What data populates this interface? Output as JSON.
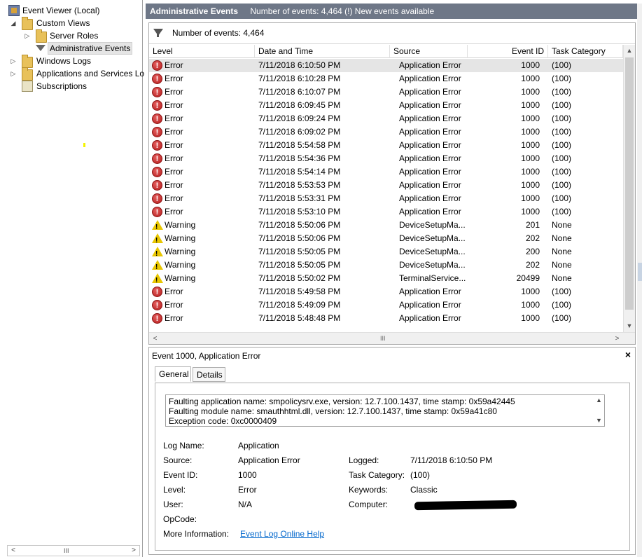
{
  "tree": {
    "items": [
      {
        "label": "Event Viewer (Local)",
        "icon": "event-viewer-icon"
      },
      {
        "label": "Custom Views",
        "icon": "folder-icon",
        "twisty": "◢"
      },
      {
        "label": "Server Roles",
        "icon": "folder-icon",
        "twisty": "▷"
      },
      {
        "label": "Administrative Events",
        "icon": "filter-icon",
        "selected": true
      },
      {
        "label": "Windows Logs",
        "icon": "folder-icon",
        "twisty": "▷"
      },
      {
        "label": "Applications and Services Lo",
        "icon": "folder-icon",
        "twisty": "▷"
      },
      {
        "label": "Subscriptions",
        "icon": "subscriptions-icon"
      }
    ],
    "scroll_left": "<",
    "scroll_right": ">",
    "scroll_grip": "III"
  },
  "header": {
    "title": "Administrative Events",
    "status": "Number of events: 4,464 (!) New events available"
  },
  "filterbar": {
    "text": "Number of events: 4,464"
  },
  "table": {
    "columns": [
      "Level",
      "Date and Time",
      "Source",
      "Event ID",
      "Task Category"
    ],
    "rows": [
      {
        "level": "Error",
        "date": "7/11/2018 6:10:50 PM",
        "source": "Application Error",
        "id": "1000",
        "cat": "(100)"
      },
      {
        "level": "Error",
        "date": "7/11/2018 6:10:28 PM",
        "source": "Application Error",
        "id": "1000",
        "cat": "(100)"
      },
      {
        "level": "Error",
        "date": "7/11/2018 6:10:07 PM",
        "source": "Application Error",
        "id": "1000",
        "cat": "(100)"
      },
      {
        "level": "Error",
        "date": "7/11/2018 6:09:45 PM",
        "source": "Application Error",
        "id": "1000",
        "cat": "(100)"
      },
      {
        "level": "Error",
        "date": "7/11/2018 6:09:24 PM",
        "source": "Application Error",
        "id": "1000",
        "cat": "(100)"
      },
      {
        "level": "Error",
        "date": "7/11/2018 6:09:02 PM",
        "source": "Application Error",
        "id": "1000",
        "cat": "(100)"
      },
      {
        "level": "Error",
        "date": "7/11/2018 5:54:58 PM",
        "source": "Application Error",
        "id": "1000",
        "cat": "(100)"
      },
      {
        "level": "Error",
        "date": "7/11/2018 5:54:36 PM",
        "source": "Application Error",
        "id": "1000",
        "cat": "(100)"
      },
      {
        "level": "Error",
        "date": "7/11/2018 5:54:14 PM",
        "source": "Application Error",
        "id": "1000",
        "cat": "(100)"
      },
      {
        "level": "Error",
        "date": "7/11/2018 5:53:53 PM",
        "source": "Application Error",
        "id": "1000",
        "cat": "(100)"
      },
      {
        "level": "Error",
        "date": "7/11/2018 5:53:31 PM",
        "source": "Application Error",
        "id": "1000",
        "cat": "(100)"
      },
      {
        "level": "Error",
        "date": "7/11/2018 5:53:10 PM",
        "source": "Application Error",
        "id": "1000",
        "cat": "(100)"
      },
      {
        "level": "Warning",
        "date": "7/11/2018 5:50:06 PM",
        "source": "DeviceSetupMa...",
        "id": "201",
        "cat": "None"
      },
      {
        "level": "Warning",
        "date": "7/11/2018 5:50:06 PM",
        "source": "DeviceSetupMa...",
        "id": "202",
        "cat": "None"
      },
      {
        "level": "Warning",
        "date": "7/11/2018 5:50:05 PM",
        "source": "DeviceSetupMa...",
        "id": "200",
        "cat": "None"
      },
      {
        "level": "Warning",
        "date": "7/11/2018 5:50:05 PM",
        "source": "DeviceSetupMa...",
        "id": "202",
        "cat": "None"
      },
      {
        "level": "Warning",
        "date": "7/11/2018 5:50:02 PM",
        "source": "TerminalService...",
        "id": "20499",
        "cat": "None"
      },
      {
        "level": "Error",
        "date": "7/11/2018 5:49:58 PM",
        "source": "Application Error",
        "id": "1000",
        "cat": "(100)"
      },
      {
        "level": "Error",
        "date": "7/11/2018 5:49:09 PM",
        "source": "Application Error",
        "id": "1000",
        "cat": "(100)"
      },
      {
        "level": "Error",
        "date": "7/11/2018 5:48:48 PM",
        "source": "Application Error",
        "id": "1000",
        "cat": "(100)"
      }
    ],
    "scroll_grip": "III"
  },
  "detail": {
    "title": "Event 1000, Application Error",
    "close": "×",
    "tabs": [
      "General",
      "Details"
    ],
    "description": [
      "Faulting application name: smpolicysrv.exe, version: 12.7.100.1437, time stamp: 0x59a42445",
      "Faulting module name: smauthhtml.dll, version: 12.7.100.1437, time stamp: 0x59a41c80",
      "Exception code: 0xc0000409"
    ],
    "fields": {
      "log_name_label": "Log Name:",
      "log_name": "Application",
      "source_label": "Source:",
      "source": "Application Error",
      "event_id_label": "Event ID:",
      "event_id": "1000",
      "level_label": "Level:",
      "level": "Error",
      "user_label": "User:",
      "user": "N/A",
      "opcode_label": "OpCode:",
      "more_info_label": "More Information:",
      "more_info_link": "Event Log Online Help",
      "logged_label": "Logged:",
      "logged": "7/11/2018 6:10:50 PM",
      "task_category_label": "Task Category:",
      "task_category": "(100)",
      "keywords_label": "Keywords:",
      "keywords": "Classic",
      "computer_label": "Computer:"
    }
  },
  "colors": {
    "titlebar": "#6e7787",
    "error": "#c62828",
    "warning": "#e8c600",
    "link": "#0066cc"
  }
}
